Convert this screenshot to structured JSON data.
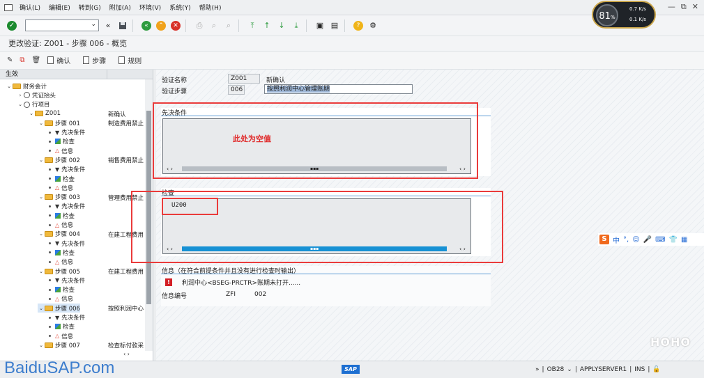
{
  "menu": {
    "items": [
      "确认(L)",
      "编辑(E)",
      "转到(G)",
      "附加(A)",
      "环境(V)",
      "系统(Y)",
      "帮助(H)"
    ],
    "window_controls": [
      "—",
      "⧉",
      "✕"
    ]
  },
  "toolbar": {
    "command_field_value": "",
    "dropdown_glyph": "⌄"
  },
  "title": "更改验证: Z001 - 步骤 006 - 概览",
  "app_toolbar": {
    "confirm": "确认",
    "step": "步骤",
    "rule": "规则"
  },
  "tree": {
    "header": "生效",
    "nodes": [
      {
        "label": "财务会计",
        "desc": ""
      },
      {
        "label": "凭证抬头",
        "desc": ""
      },
      {
        "label": "行项目",
        "desc": ""
      },
      {
        "label": "Z001",
        "desc": "新确认"
      },
      {
        "label": "步骤 001",
        "desc": "制造费用禁止"
      },
      {
        "label": "先决条件",
        "desc": ""
      },
      {
        "label": "检查",
        "desc": ""
      },
      {
        "label": "信息",
        "desc": ""
      },
      {
        "label": "步骤 002",
        "desc": "销售费用禁止"
      },
      {
        "label": "先决条件",
        "desc": ""
      },
      {
        "label": "检查",
        "desc": ""
      },
      {
        "label": "信息",
        "desc": ""
      },
      {
        "label": "步骤 003",
        "desc": "管理费用禁止"
      },
      {
        "label": "先决条件",
        "desc": ""
      },
      {
        "label": "检查",
        "desc": ""
      },
      {
        "label": "信息",
        "desc": ""
      },
      {
        "label": "步骤 004",
        "desc": "在建工程费用"
      },
      {
        "label": "先决条件",
        "desc": ""
      },
      {
        "label": "检查",
        "desc": ""
      },
      {
        "label": "信息",
        "desc": ""
      },
      {
        "label": "步骤 005",
        "desc": "在建工程费用"
      },
      {
        "label": "先决条件",
        "desc": ""
      },
      {
        "label": "检查",
        "desc": ""
      },
      {
        "label": "信息",
        "desc": ""
      },
      {
        "label": "步骤 006",
        "desc": "按照利润中心"
      },
      {
        "label": "先决条件",
        "desc": ""
      },
      {
        "label": "检查",
        "desc": ""
      },
      {
        "label": "信息",
        "desc": ""
      },
      {
        "label": "步骤 007",
        "desc": "检查标付款采"
      }
    ],
    "hscroll": "‹ ›"
  },
  "form": {
    "validation_name_label": "验证名称",
    "validation_name_value": "Z001",
    "validation_name_desc": "新确认",
    "step_label": "验证步骤",
    "step_value": "006",
    "step_desc": "按照利润中心管理账期"
  },
  "prereq": {
    "title": "先决条件",
    "code": "",
    "annotation": "此处为空值",
    "scroll_left": "‹ ›",
    "scroll_mid": "▪▪▪",
    "scroll_right": "‹ ›"
  },
  "check": {
    "title": "检查",
    "code": "U200",
    "scroll_left": "‹ ›",
    "scroll_mid": "▪▪▪",
    "scroll_right": "‹ ›"
  },
  "message": {
    "title": "信息（在符合前提条件并且没有进行检查时输出）",
    "icon_text": "!",
    "text": "利润中心<BSEG-PRCTR>账期未打开......",
    "number_label": "信息编号",
    "msg_class": "ZFI",
    "msg_number": "002"
  },
  "status": {
    "sap": "SAP",
    "arrows": "»",
    "system": "OB28",
    "server": "APPLYSERVER1",
    "mode": "INS"
  },
  "overlay": {
    "cpu": "81",
    "cpu_unit": "%",
    "up_speed": "0.7 K/s",
    "down_speed": "0.1 K/s",
    "ime_text": "中",
    "hoho": "HOHO",
    "watermark": "BaiduSAP.com"
  }
}
